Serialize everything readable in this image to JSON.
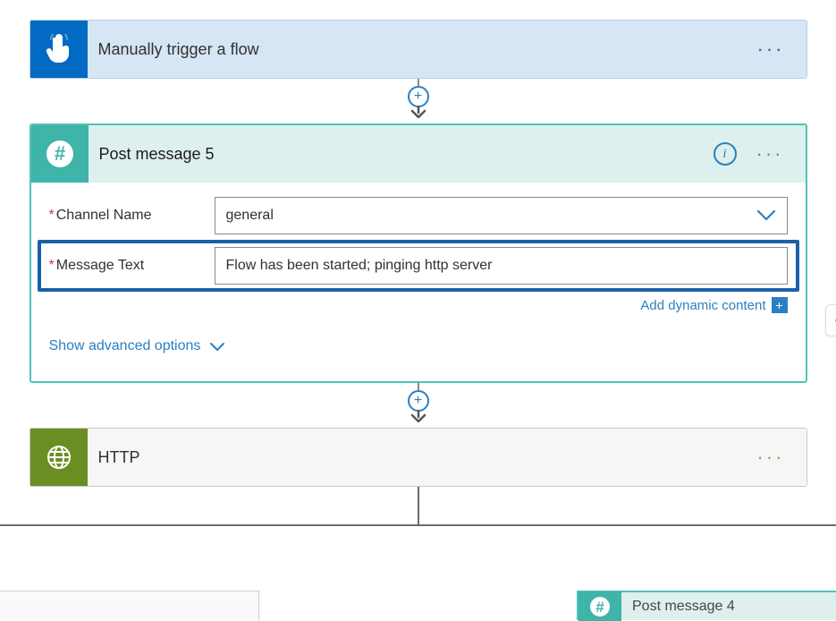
{
  "trigger": {
    "title": "Manually trigger a flow",
    "colors": {
      "accent": "#036ac4",
      "bg": "#d6e6f5"
    }
  },
  "slack_action": {
    "title": "Post message 5",
    "channel_label": "Channel Name",
    "channel_value": "general",
    "message_label": "Message Text",
    "message_value": "Flow has been started; pinging http server",
    "dynamic_link": "Add dynamic content",
    "advanced_toggle": "Show advanced options",
    "colors": {
      "accent": "#3fb4a8",
      "bg": "#def0ed"
    }
  },
  "http_action": {
    "title": "HTTP",
    "colors": {
      "accent": "#6b8e23"
    }
  },
  "bottom_right_card": {
    "title": "Post message 4"
  },
  "icons": {
    "tap": "tap-icon",
    "hash": "hash-icon",
    "globe": "globe-icon",
    "info": "info-icon",
    "plus": "+",
    "ellipsis": "ellipsis-icon",
    "chevron_down": "chevron-down-icon"
  }
}
